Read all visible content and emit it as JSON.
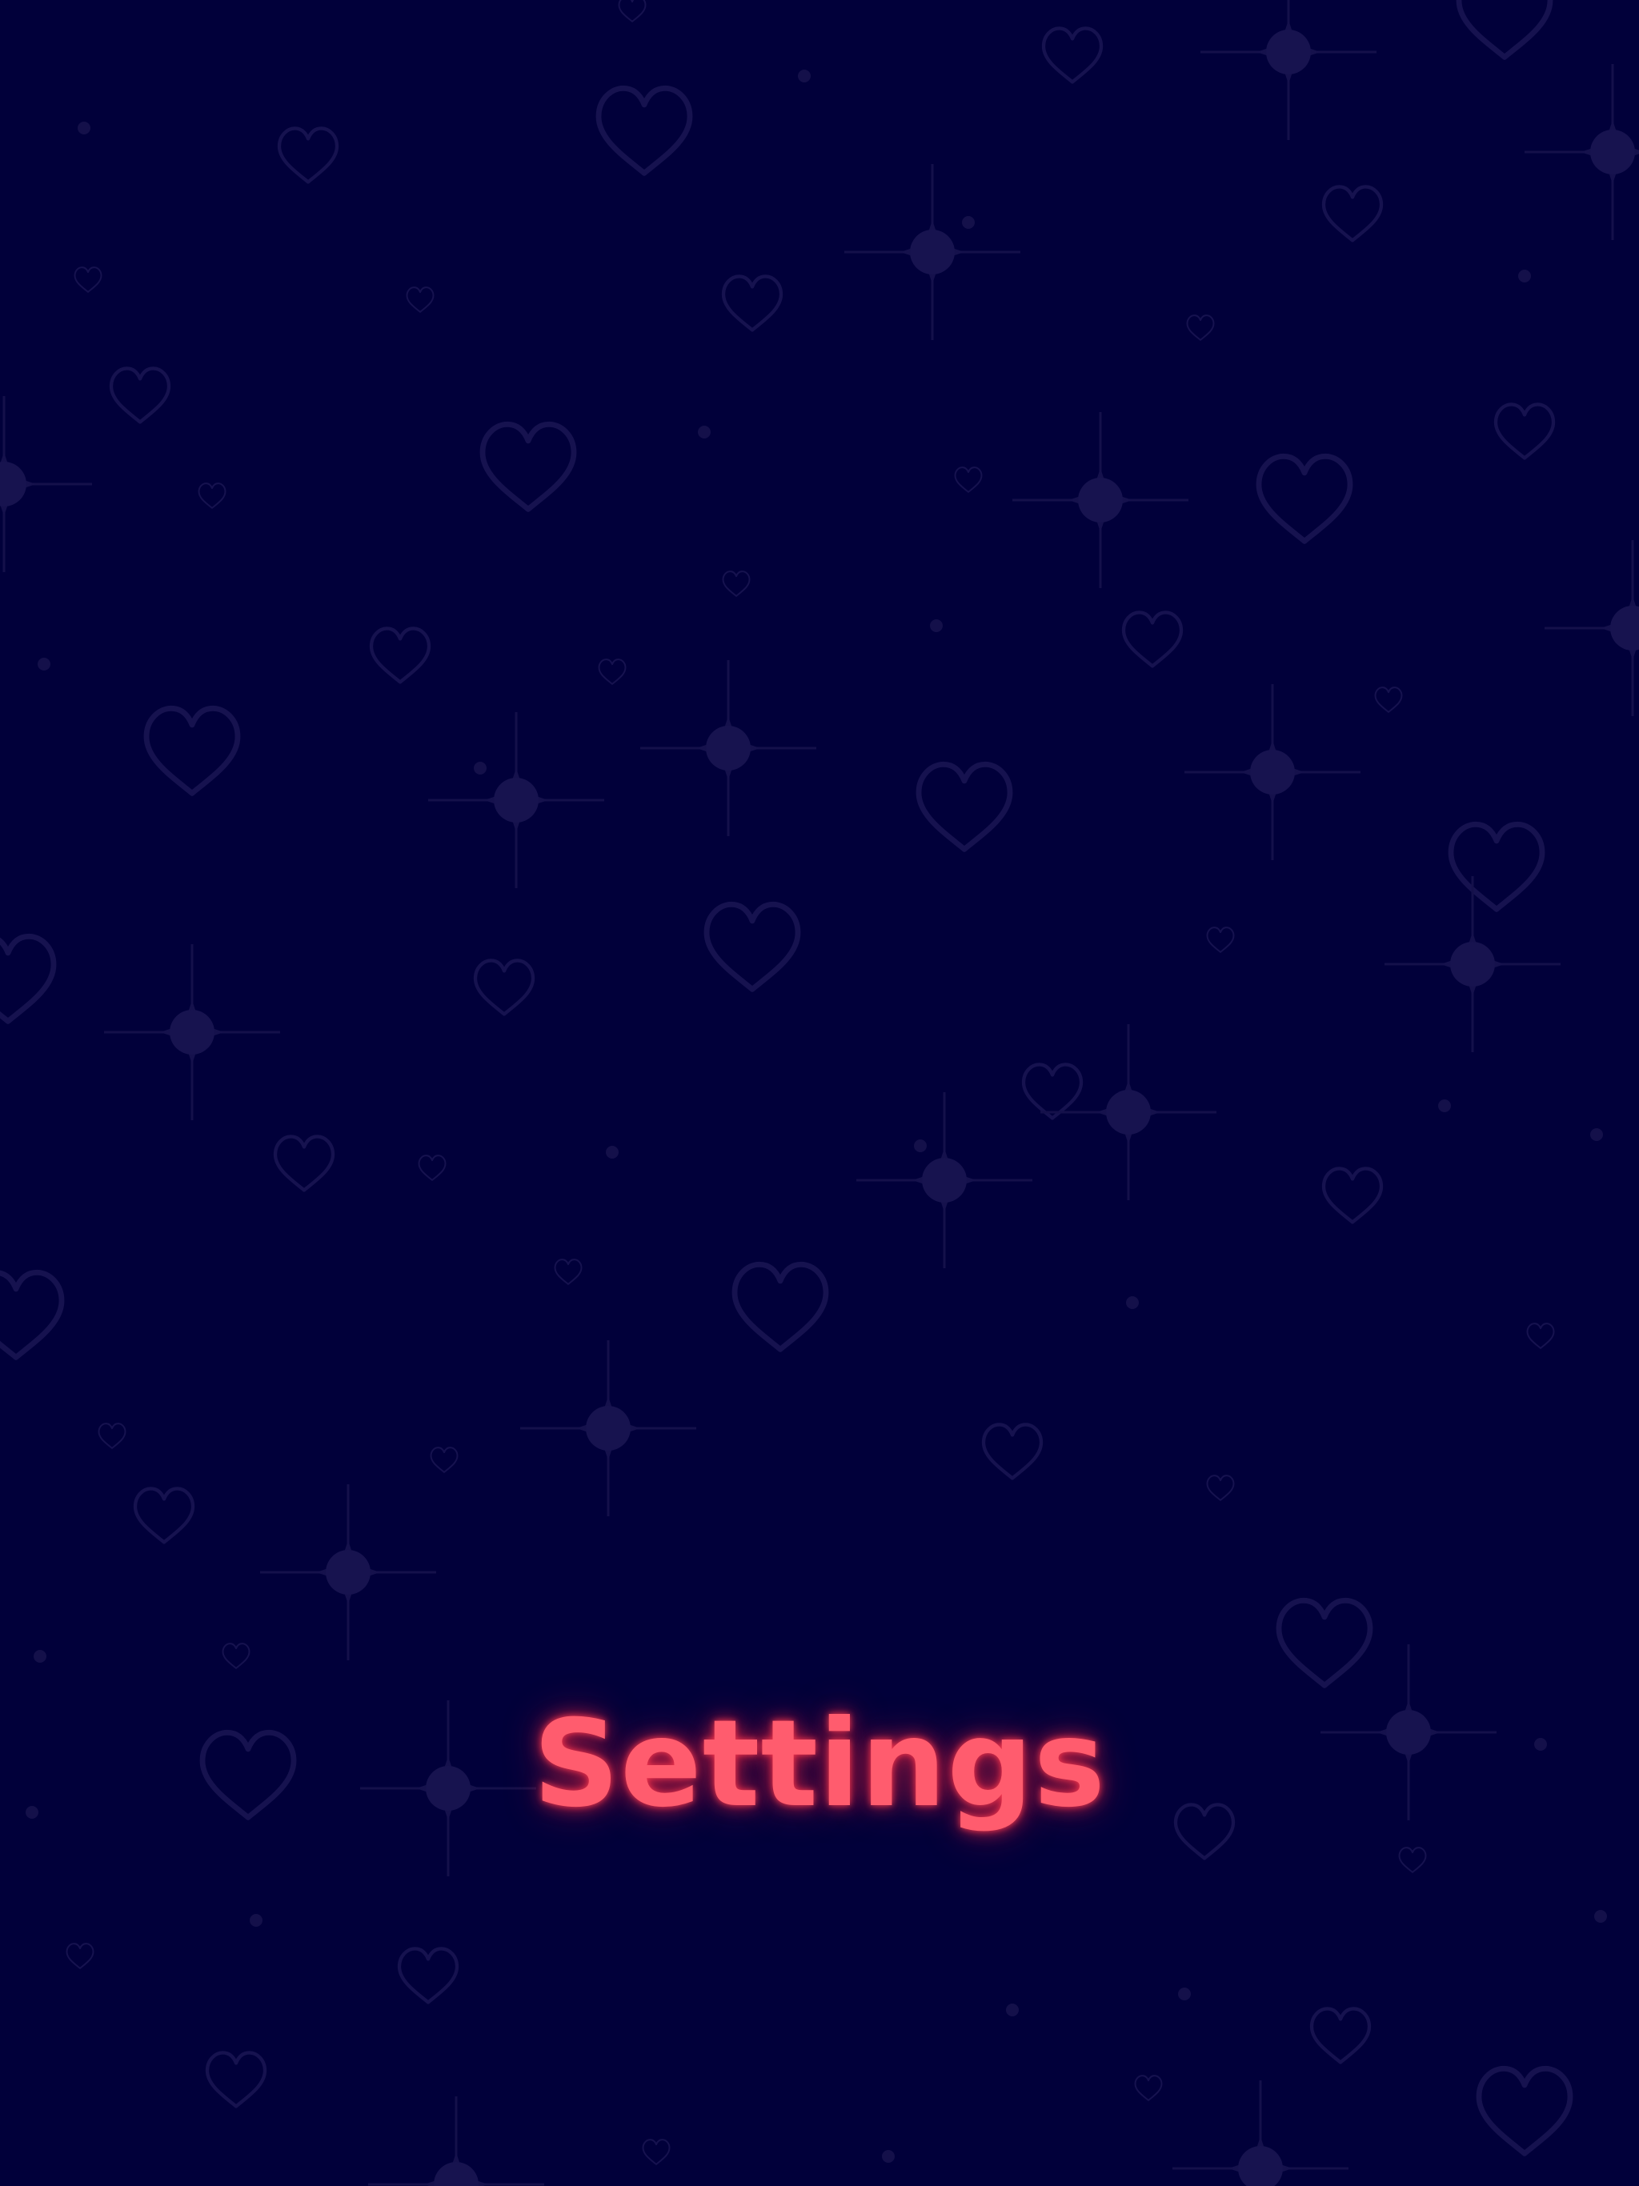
{
  "screen": {
    "title": "Settings"
  },
  "colors": {
    "background": "#01003a",
    "decor": "#16124f",
    "title": "#ff5c6e",
    "title_glow": "#ff2846"
  },
  "background": {
    "icons": [
      "heart-outline-icon",
      "sparkle-icon",
      "dot"
    ]
  }
}
